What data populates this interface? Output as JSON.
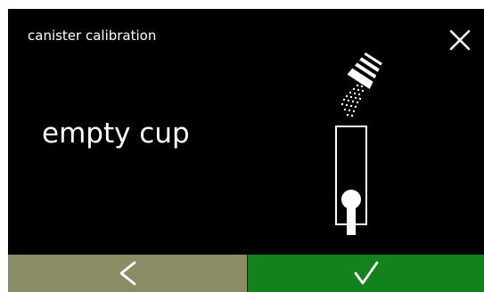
{
  "header": {
    "title": "canister calibration",
    "close_icon": "close-icon"
  },
  "main": {
    "instruction": "empty cup",
    "illustration": "canister-pouring-into-cup-icon"
  },
  "footer": {
    "back_icon": "chevron-left-icon",
    "confirm_icon": "checkmark-icon"
  },
  "colors": {
    "screen_background": "#000000",
    "text": "#ffffff",
    "back_button": "#8b8c63",
    "confirm_button": "#13811d"
  }
}
